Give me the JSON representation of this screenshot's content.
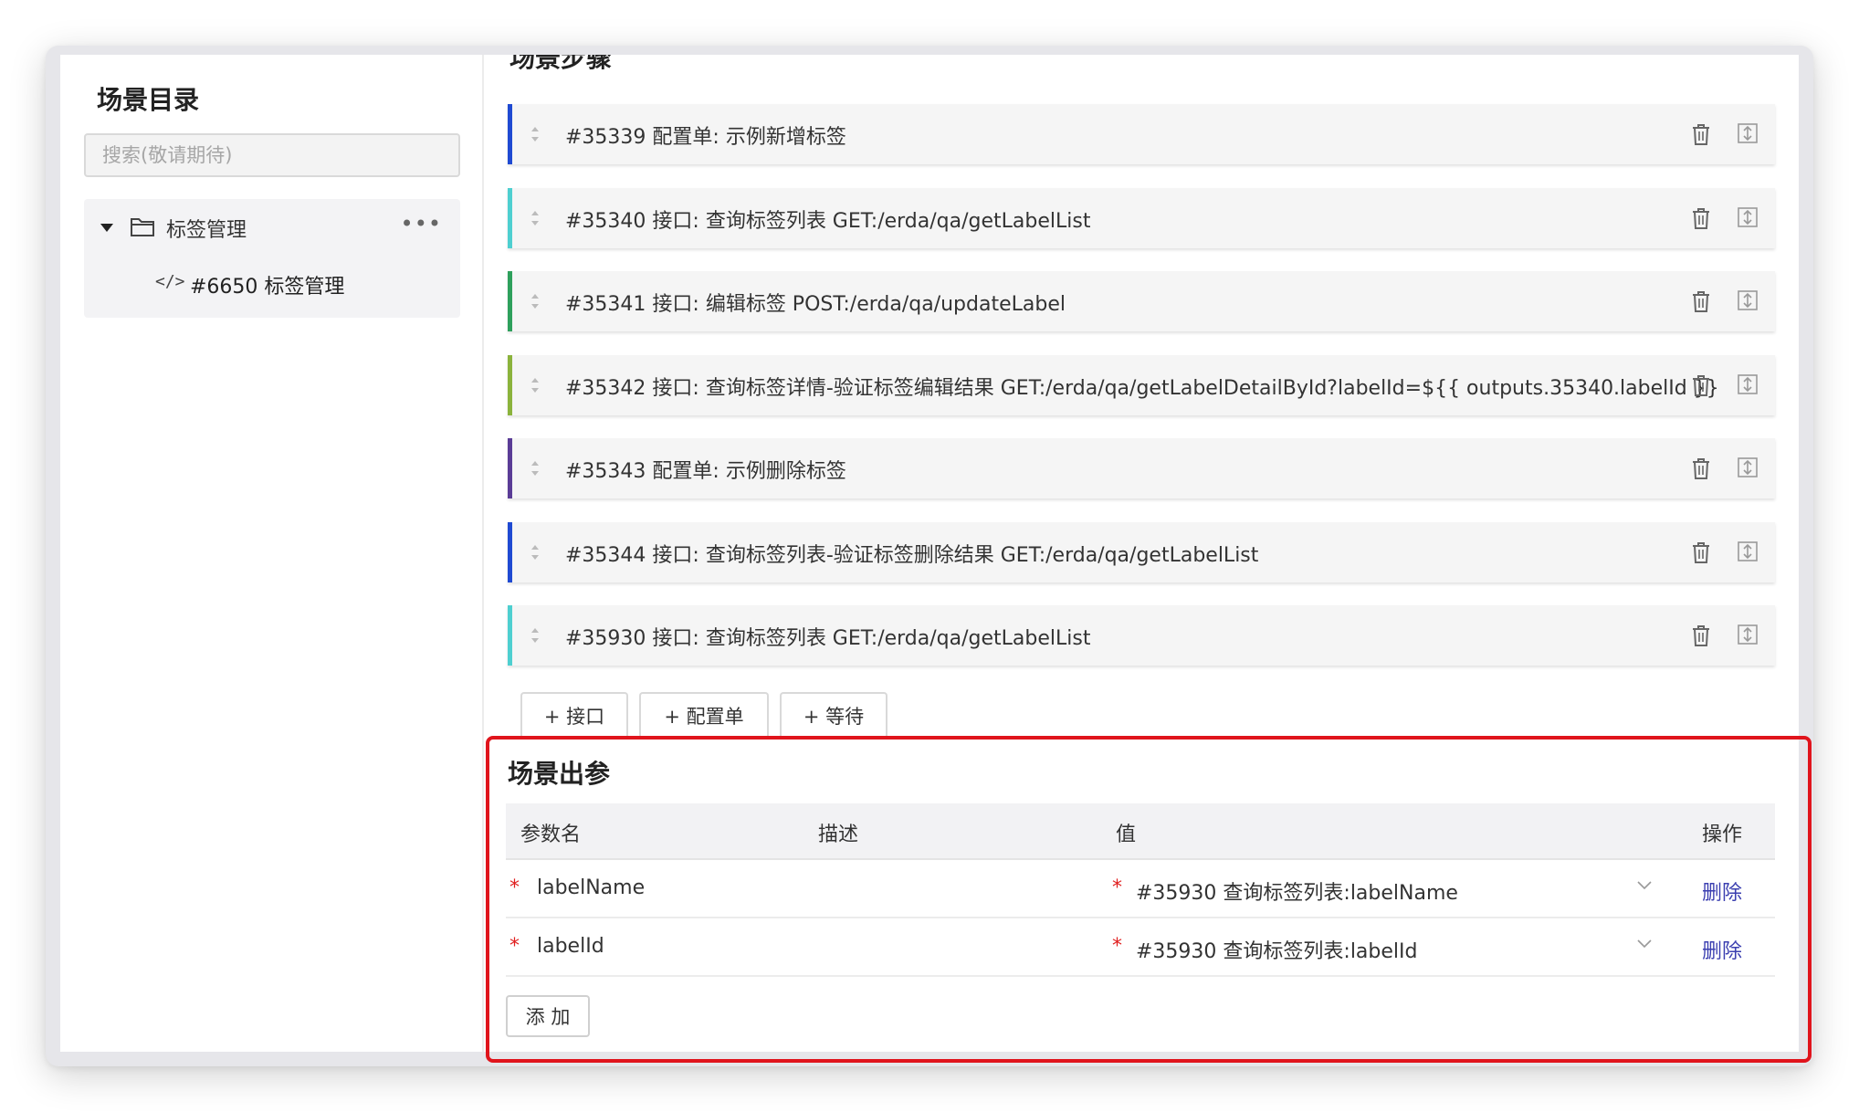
{
  "sidebar": {
    "title": "场景目录",
    "search_placeholder": "搜索(敬请期待)",
    "folder": {
      "label": "标签管理"
    },
    "leaf": {
      "label": "#6650 标签管理"
    }
  },
  "main": {
    "steps_title": "场景步骤",
    "steps": [
      {
        "text": "#35339 配置单: 示例新增标签",
        "color": "#1f4ad2"
      },
      {
        "text": "#35340 接口: 查询标签列表 GET:/erda/qa/getLabelList",
        "color": "#4ecfd0"
      },
      {
        "text": "#35341 接口: 编辑标签 POST:/erda/qa/updateLabel",
        "color": "#2ea05c"
      },
      {
        "text": "#35342 接口: 查询标签详情-验证标签编辑结果 GET:/erda/qa/getLabelDetailById?labelId=${{ outputs.35340.labelId }}",
        "color": "#8bb33c"
      },
      {
        "text": "#35343 配置单: 示例删除标签",
        "color": "#5a3c96"
      },
      {
        "text": "#35344 接口: 查询标签列表-验证标签删除结果 GET:/erda/qa/getLabelList",
        "color": "#1f4ad2"
      },
      {
        "text": "#35930 接口: 查询标签列表 GET:/erda/qa/getLabelList",
        "color": "#4ecfd0"
      }
    ],
    "add_buttons": {
      "api": "+ 接口",
      "config": "+ 配置单",
      "wait": "+ 等待"
    }
  },
  "outparams": {
    "title": "场景出参",
    "columns": {
      "name": "参数名",
      "desc": "描述",
      "value": "值",
      "action": "操作"
    },
    "rows": [
      {
        "required": "*",
        "name": "labelName",
        "value": "#35930 查询标签列表:labelName",
        "action": "删除"
      },
      {
        "required": "*",
        "name": "labelId",
        "value": "#35930 查询标签列表:labelId",
        "action": "删除"
      }
    ],
    "add_label": "添 加"
  },
  "colors": {
    "highlight": "#e0141c",
    "link": "#3b3fb0",
    "required": "#e02020"
  }
}
